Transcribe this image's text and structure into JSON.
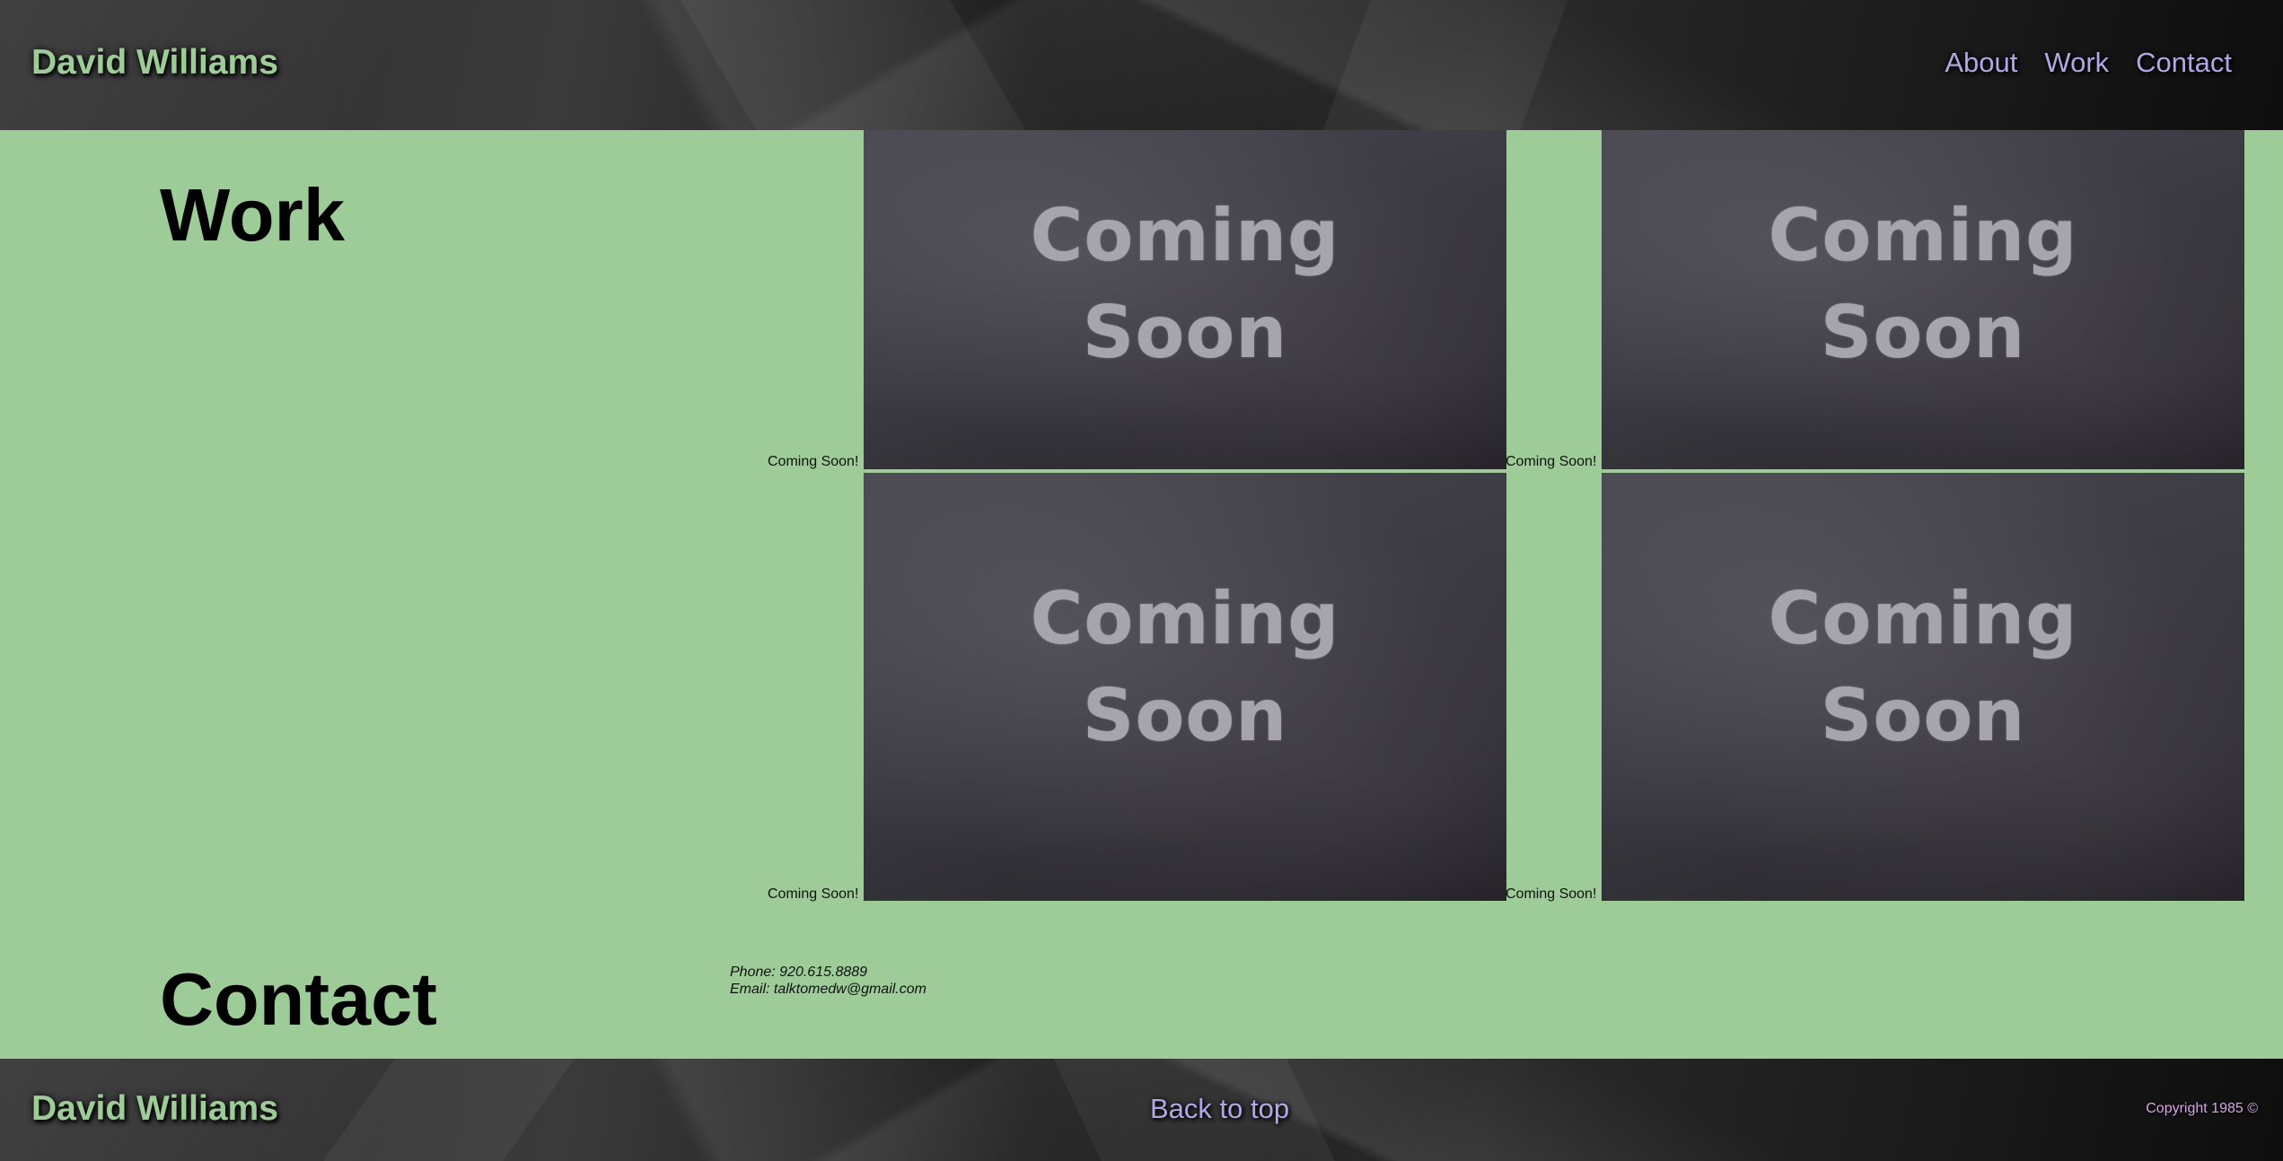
{
  "header": {
    "brand": "David Williams",
    "nav": [
      {
        "label": "About"
      },
      {
        "label": "Work"
      },
      {
        "label": "Contact"
      }
    ]
  },
  "work": {
    "title": "Work",
    "tiles": [
      {
        "caption": "Coming Soon!",
        "image_text_line1": "Coming",
        "image_text_line2": "Soon"
      },
      {
        "caption": "Coming Soon!",
        "image_text_line1": "Coming",
        "image_text_line2": "Soon"
      },
      {
        "caption": "Coming Soon!",
        "image_text_line1": "Coming",
        "image_text_line2": "Soon"
      },
      {
        "caption": "Coming Soon!",
        "image_text_line1": "Coming",
        "image_text_line2": "Soon"
      }
    ]
  },
  "contact": {
    "title": "Contact",
    "phone": "Phone: 920.615.8889",
    "email": "Email: talktomedw@gmail.com"
  },
  "footer": {
    "brand": "David Williams",
    "back_to_top": "Back to top",
    "copyright": "Copyright 1985 ©"
  },
  "colors": {
    "page_background": "#9dcc98",
    "brand_text": "#9dcc98",
    "nav_link": "#aea8e6",
    "copyright": "#d6a6e8"
  }
}
